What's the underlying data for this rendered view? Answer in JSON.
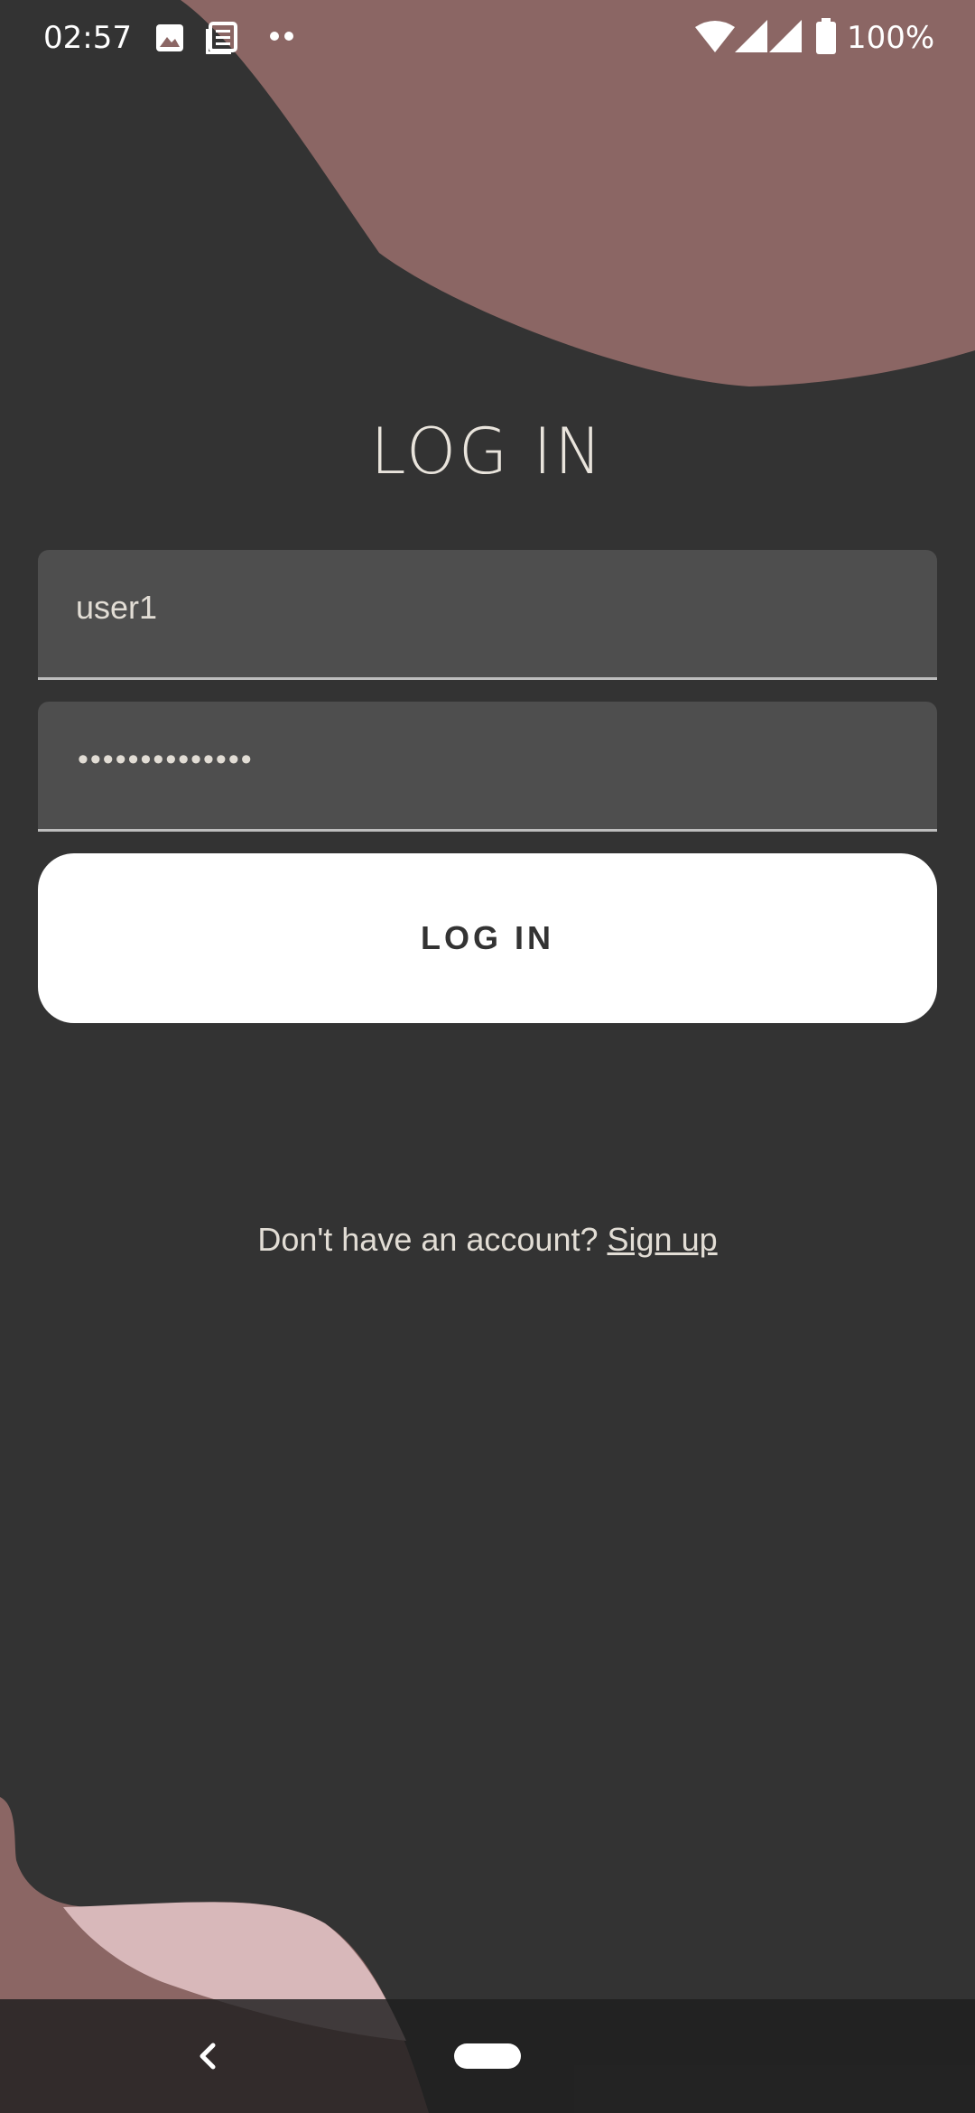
{
  "status_bar": {
    "time": "02:57",
    "battery": "100%",
    "icons": [
      "image-icon",
      "news-icon",
      "more-dots-icon",
      "wifi-icon",
      "signal-icon",
      "signal-icon",
      "battery-icon"
    ]
  },
  "title": "LOG IN",
  "username": {
    "value": "user1"
  },
  "password": {
    "masked_value": "••••••••••••••"
  },
  "login_button": {
    "label": "LOG IN"
  },
  "signup": {
    "prompt": "Don't have an account?",
    "link": "Sign up"
  },
  "colors": {
    "background": "#333333",
    "accent_mauve": "#8b6664",
    "accent_pink": "#d8b8ba",
    "field": "#4e4e4e",
    "button": "#ffffff",
    "text": "#e2ddd5"
  },
  "nav_bar": {
    "icons": [
      "back-icon",
      "home-pill-icon"
    ]
  }
}
